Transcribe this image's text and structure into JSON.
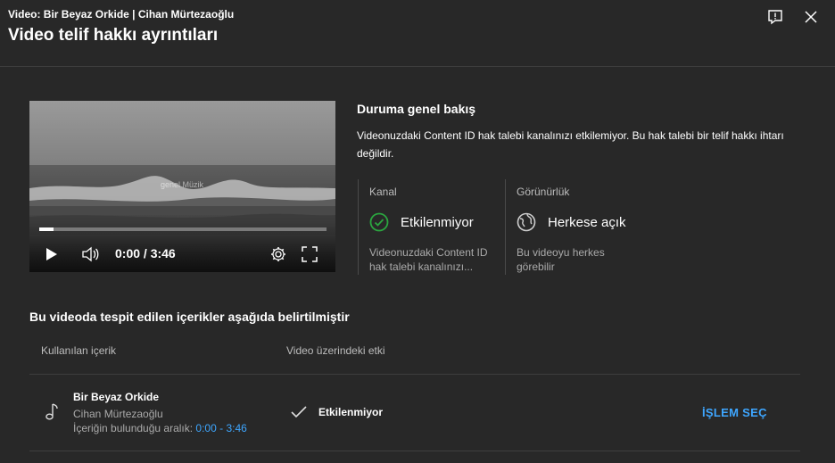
{
  "header": {
    "subtitle": "Video: Bir Beyaz Orkide | Cihan Mürtezaoğlu",
    "title": "Video telif hakkı ayrıntıları"
  },
  "player": {
    "time": "0:00 / 3:46",
    "watermark": "genel Müzik",
    "progress": 0.05
  },
  "overview": {
    "title": "Duruma genel bakış",
    "text": "Videonuzdaki Content ID hak talebi kanalınızı etkilemiyor. Bu hak talebi bir telif hakkı ihtarı değildir."
  },
  "cards": {
    "channel": {
      "heading": "Kanal",
      "value": "Etkilenmiyor",
      "desc": "Videonuzdaki Content ID hak talebi kanalınızı..."
    },
    "visibility": {
      "heading": "Görünürlük",
      "value": "Herkese açık",
      "desc": "Bu videoyu herkes görebilir"
    }
  },
  "content": {
    "section_title": "Bu videoda tespit edilen içerikler aşağıda belirtilmiştir",
    "col_used": "Kullanılan içerik",
    "col_effect": "Video üzerindeki etki",
    "row": {
      "title": "Bir Beyaz Orkide",
      "artist": "Cihan Mürtezaoğlu",
      "range_label": "İçeriğin bulunduğu aralık: ",
      "range": "0:00 - 3:46",
      "effect": "Etkilenmiyor",
      "action": "İŞLEM SEÇ"
    }
  },
  "colors": {
    "background": "#282828",
    "accent": "#3ea6ff",
    "ok_green": "#2ba640"
  }
}
